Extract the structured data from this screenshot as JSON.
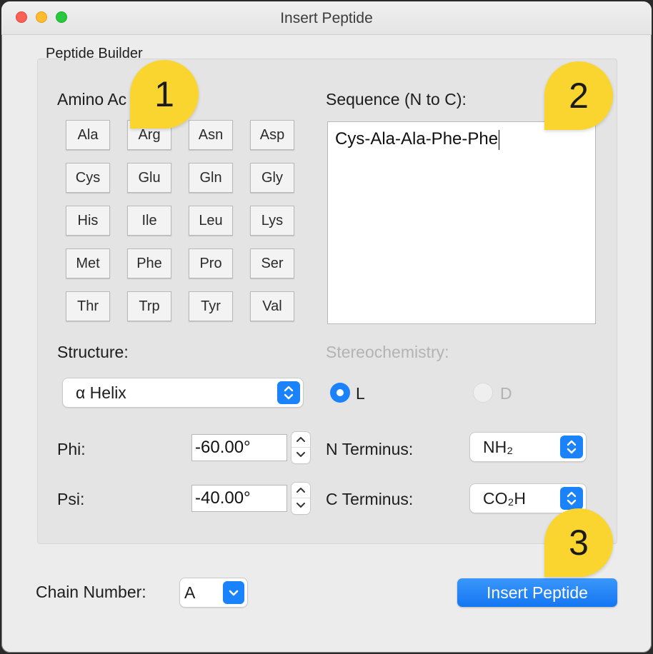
{
  "window": {
    "title": "Insert Peptide"
  },
  "group": {
    "label": "Peptide Builder"
  },
  "amino_acids": {
    "label": "Amino Acids:",
    "visible_label": "Amino Ac",
    "buttons": [
      "Ala",
      "Arg",
      "Asn",
      "Asp",
      "Cys",
      "Glu",
      "Gln",
      "Gly",
      "His",
      "Ile",
      "Leu",
      "Lys",
      "Met",
      "Phe",
      "Pro",
      "Ser",
      "Thr",
      "Trp",
      "Tyr",
      "Val"
    ]
  },
  "sequence": {
    "label": "Sequence (N to C):",
    "value": "Cys-Ala-Ala-Phe-Phe"
  },
  "structure": {
    "label": "Structure:",
    "selected": "α Helix"
  },
  "stereochemistry": {
    "label": "Stereochemistry:",
    "options": [
      "L",
      "D"
    ],
    "selected": "L"
  },
  "phi": {
    "label": "Phi:",
    "value": "-60.00°"
  },
  "psi": {
    "label": "Psi:",
    "value": "-40.00°"
  },
  "n_terminus": {
    "label": "N Terminus:",
    "selected": "NH₂"
  },
  "c_terminus": {
    "label": "C Terminus:",
    "selected": "CO₂H"
  },
  "chain": {
    "label": "Chain Number:",
    "selected": "A"
  },
  "insert_button": {
    "label": "Insert Peptide"
  },
  "callouts": [
    "1",
    "2",
    "3"
  ],
  "colors": {
    "accent": "#1a82fb",
    "callout": "#fad530",
    "window_bg": "#ececec"
  }
}
